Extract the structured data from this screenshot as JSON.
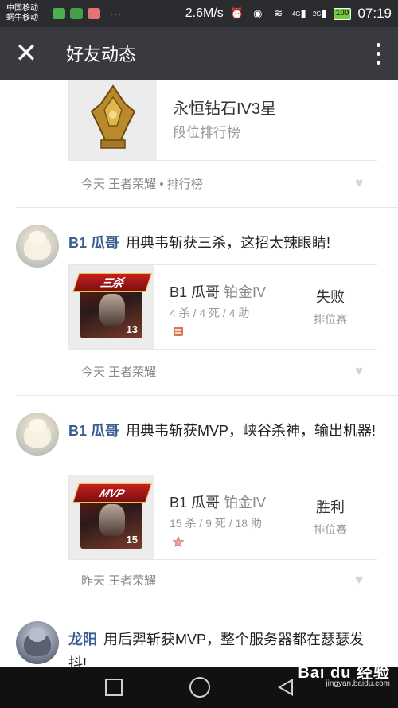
{
  "statusbar": {
    "carrier1": "中国移动",
    "carrier2": "蜗牛移动",
    "dots": "···",
    "speed": "2.6M/s",
    "net_4g": "4G",
    "net_2g": "2G",
    "battery": "100",
    "time": "07:19"
  },
  "titlebar": {
    "close_glyph": "✕",
    "title": "好友动态"
  },
  "posts": [
    {
      "card_title": "永恒钻石IV3星",
      "card_subtitle": "段位排行榜",
      "footer": "今天  王者荣耀 • 排行榜"
    },
    {
      "username": "B1 瓜哥",
      "text": "用典韦斩获三杀，这招太辣眼睛!",
      "ribbon": "三杀",
      "hero_level": "13",
      "player": "B1 瓜哥",
      "rank": "铂金IV",
      "stats": "4 杀 / 4 死 / 4 助",
      "result": "失败",
      "mode": "排位赛",
      "footer": "今天  王者荣耀"
    },
    {
      "username": "B1 瓜哥",
      "text": "用典韦斩获MVP，峡谷杀神，输出机器!",
      "ribbon": "MVP",
      "hero_level": "15",
      "player": "B1 瓜哥",
      "rank": "铂金IV",
      "stats": "15 杀 / 9 死 / 18 助",
      "result": "胜利",
      "mode": "排位赛",
      "footer": "昨天  王者荣耀"
    },
    {
      "username": "龙阳",
      "text": "用后羿斩获MVP，整个服务器都在瑟瑟发抖!"
    }
  ],
  "watermark": {
    "main": "Bai du 经验",
    "sub": "jingyan.baidu.com"
  },
  "colors": {
    "statusbar": "#2b2c30",
    "titlebar": "#393a3f",
    "username": "#3c5d93"
  }
}
